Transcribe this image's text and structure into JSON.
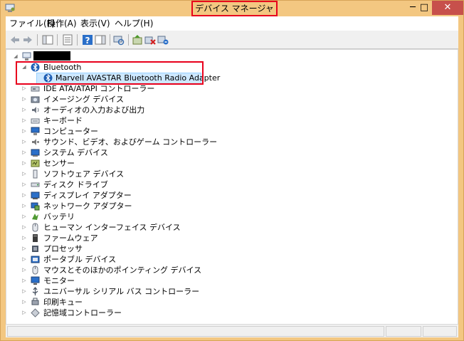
{
  "window": {
    "title": "デバイス マネージャー",
    "controls": {
      "minimize": "─",
      "maximize": "□",
      "close": "✕"
    }
  },
  "menu": [
    "ファイル(F)",
    "操作(A)",
    "表示(V)",
    "ヘルプ(H)"
  ],
  "toolbar": {
    "buttons": [
      "back-icon",
      "forward-icon",
      "show-hide-console-tree-icon",
      "properties-icon",
      "help-icon",
      "action-pane-icon",
      "scan-hardware-icon",
      "update-driver-icon",
      "uninstall-icon",
      "disable-device-icon"
    ]
  },
  "tree": {
    "root": {
      "label": "",
      "expanded": true
    },
    "bluetooth": {
      "label": "Bluetooth",
      "expanded": true,
      "child": "Marvell AVASTAR Bluetooth Radio Adapter"
    },
    "categories": [
      {
        "label": "IDE ATA/ATAPI コントローラー",
        "icon": "ide-controller-icon"
      },
      {
        "label": "イメージング デバイス",
        "icon": "imaging-device-icon"
      },
      {
        "label": "オーディオの入力および出力",
        "icon": "audio-io-icon"
      },
      {
        "label": "キーボード",
        "icon": "keyboard-icon"
      },
      {
        "label": "コンピューター",
        "icon": "computer-icon"
      },
      {
        "label": "サウンド、ビデオ、およびゲーム コントローラー",
        "icon": "sound-video-game-icon"
      },
      {
        "label": "システム デバイス",
        "icon": "system-device-icon"
      },
      {
        "label": "センサー",
        "icon": "sensor-icon"
      },
      {
        "label": "ソフトウェア デバイス",
        "icon": "software-device-icon"
      },
      {
        "label": "ディスク ドライブ",
        "icon": "disk-drive-icon"
      },
      {
        "label": "ディスプレイ アダプター",
        "icon": "display-adapter-icon"
      },
      {
        "label": "ネットワーク アダプター",
        "icon": "network-adapter-icon"
      },
      {
        "label": "バッテリ",
        "icon": "battery-icon"
      },
      {
        "label": "ヒューマン インターフェイス デバイス",
        "icon": "hid-icon"
      },
      {
        "label": "ファームウェア",
        "icon": "firmware-icon"
      },
      {
        "label": "プロセッサ",
        "icon": "processor-icon"
      },
      {
        "label": "ポータブル デバイス",
        "icon": "portable-device-icon"
      },
      {
        "label": "マウスとそのほかのポインティング デバイス",
        "icon": "mouse-icon"
      },
      {
        "label": "モニター",
        "icon": "monitor-icon"
      },
      {
        "label": "ユニバーサル シリアル バス コントローラー",
        "icon": "usb-controller-icon"
      },
      {
        "label": "印刷キュー",
        "icon": "print-queue-icon"
      },
      {
        "label": "記憶域コントローラー",
        "icon": "storage-controller-icon"
      }
    ]
  },
  "colors": {
    "titlebar": "#f3c781",
    "highlight_box": "#e8001c",
    "selection": "#cde8ff",
    "close_button": "#c7504b"
  }
}
